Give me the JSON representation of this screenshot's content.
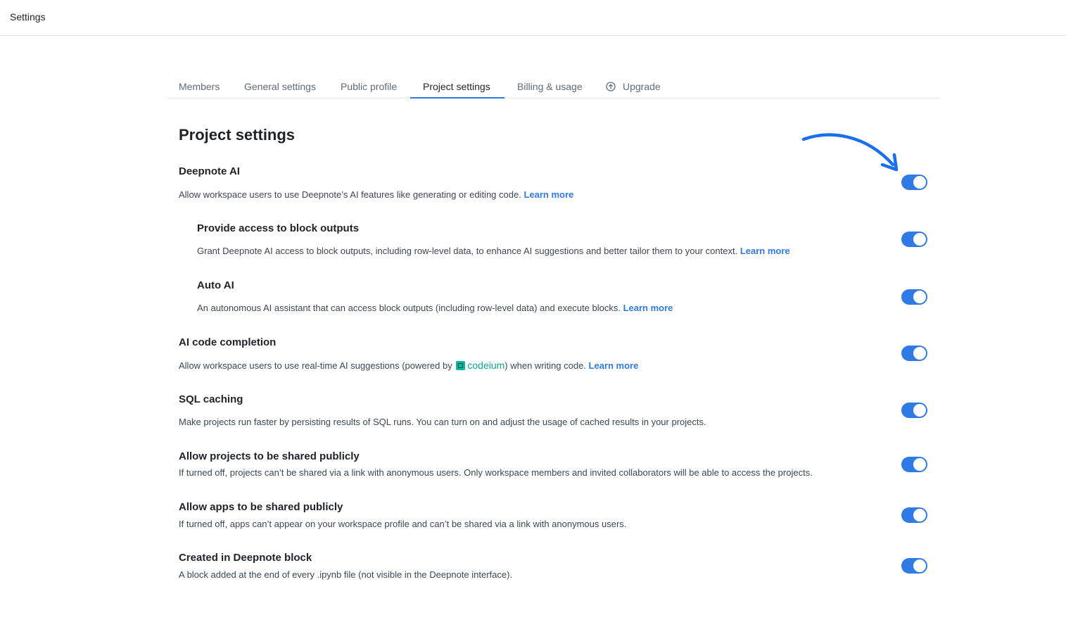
{
  "topbar": {
    "title": "Settings"
  },
  "tabs": [
    {
      "label": "Members",
      "active": false
    },
    {
      "label": "General settings",
      "active": false
    },
    {
      "label": "Public profile",
      "active": false
    },
    {
      "label": "Project settings",
      "active": true
    },
    {
      "label": "Billing & usage",
      "active": false
    },
    {
      "label": "Upgrade",
      "active": false,
      "icon": "arrow-up-circle-icon"
    }
  ],
  "page": {
    "title": "Project settings"
  },
  "settings": [
    {
      "title": "Deepnote AI",
      "description": "Allow workspace users to use Deepnote’s AI features like generating or editing code.",
      "link": "Learn more",
      "enabled": true
    },
    {
      "title": "Provide access to block outputs",
      "description": "Grant Deepnote AI access to block outputs, including row-level data, to enhance AI suggestions and better tailor them to your context.",
      "link": "Learn more",
      "enabled": true
    },
    {
      "title": "Auto AI",
      "description": "An autonomous AI assistant that can access block outputs (including row-level data) and execute blocks.",
      "link": "Learn more",
      "enabled": true
    },
    {
      "title": "AI code completion",
      "description_before": "Allow workspace users to use real-time AI suggestions (powered by",
      "brand": "codeium",
      "description_after": ") when writing code.",
      "link": "Learn more",
      "enabled": true
    },
    {
      "title": "SQL caching",
      "description": "Make projects run faster by persisting results of SQL runs. You can turn on and adjust the usage of cached results in your projects.",
      "enabled": true
    },
    {
      "title": "Allow projects to be shared publicly",
      "description": "If turned off, projects can’t be shared via a link with anonymous users. Only workspace members and invited collaborators will be able to access the projects.",
      "enabled": true
    },
    {
      "title": "Allow apps to be shared publicly",
      "description": "If turned off, apps can’t appear on your workspace profile and can’t be shared via a link with anonymous users.",
      "enabled": true
    },
    {
      "title": "Created in Deepnote block",
      "description": "A block added at the end of every .ipynb file (not visible in the Deepnote interface).",
      "enabled": true
    }
  ],
  "colors": {
    "accent": "#2f7ae5",
    "codeium": "#09a88a",
    "annotation_arrow": "#1a6ff0"
  }
}
